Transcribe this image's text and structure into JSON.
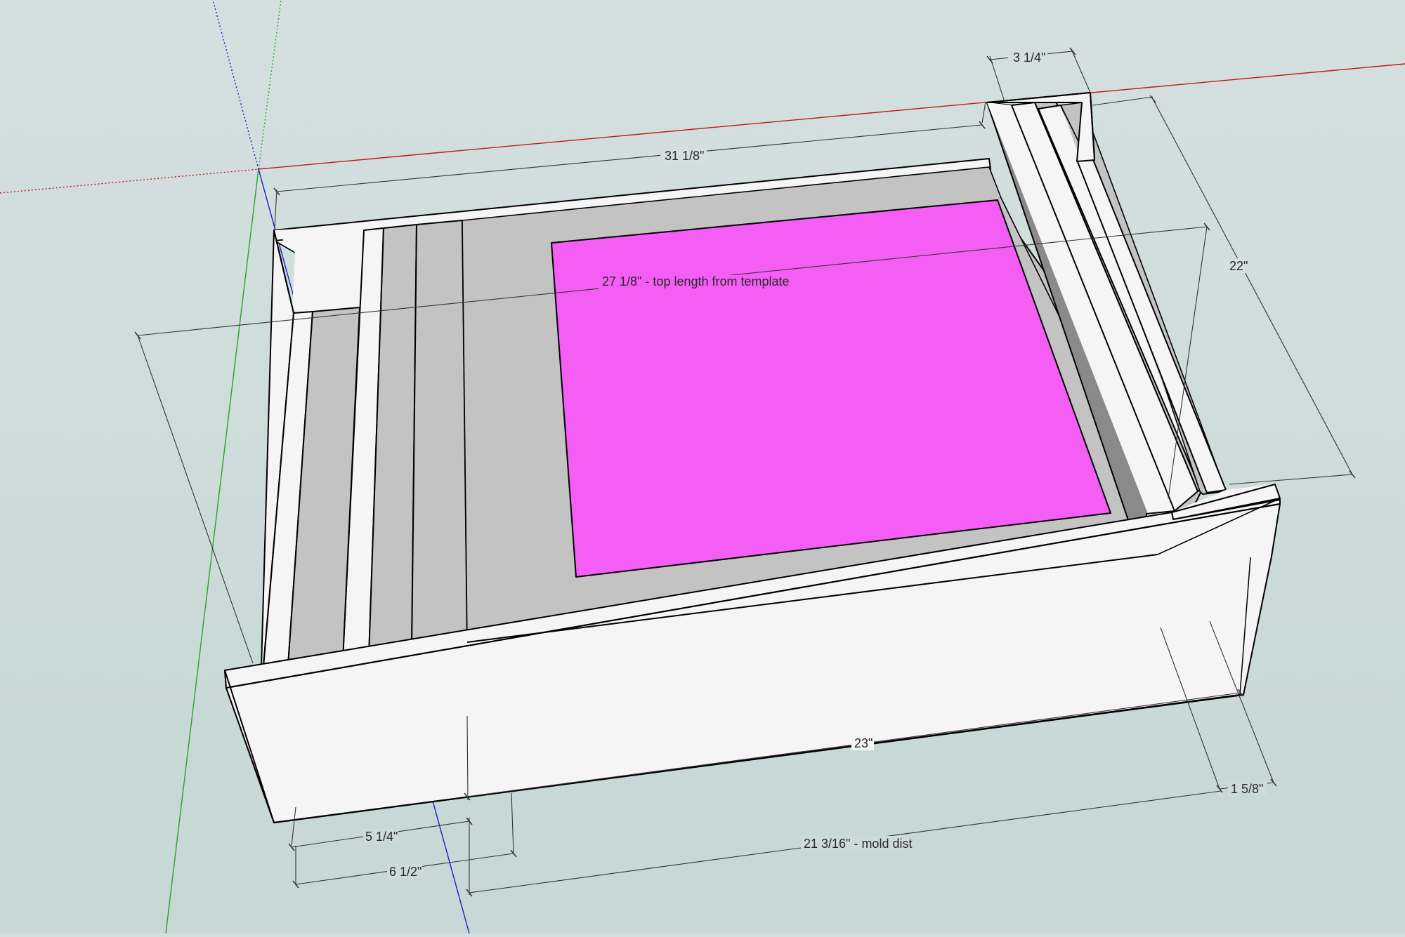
{
  "scene": {
    "background_color": "#cddbd9",
    "colors": {
      "board": "#f5f5f5",
      "channel": "#c3c3c3",
      "dark_face": "#8a8a8a",
      "template": "#f55ef5",
      "axis_red": "#c01818",
      "axis_green": "#23a623",
      "axis_blue": "#1e1ec8",
      "dimension_line": "#333333"
    }
  },
  "dimensions": {
    "width_3_1_4": "3 1/4\"",
    "length_31_1_8": "31 1/8\"",
    "depth_22": "22\"",
    "top_length": "27 1/8\" - top length from template",
    "front_23": "23\"",
    "offset_1_5_8": "1 5/8\"",
    "mold_dist": "21 3/16\" - mold dist",
    "offset_5_1_4": "5 1/4\"",
    "offset_6_1_2": "6 1/2\""
  }
}
